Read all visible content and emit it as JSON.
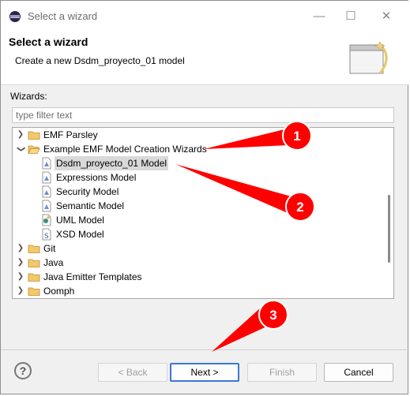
{
  "window": {
    "title": "Select a wizard"
  },
  "header": {
    "title": "Select a wizard",
    "description": "Create a new Dsdm_proyecto_01 model"
  },
  "wizards_label": "Wizards:",
  "filter": {
    "placeholder": "type filter text",
    "value": ""
  },
  "tree": {
    "items": [
      {
        "label": "EMF Parsley",
        "type": "folder",
        "expanded": false
      },
      {
        "label": "Example EMF Model Creation Wizards",
        "type": "folder",
        "expanded": true
      },
      {
        "label": "Dsdm_proyecto_01 Model",
        "type": "model",
        "selected": true
      },
      {
        "label": "Expressions Model",
        "type": "model"
      },
      {
        "label": "Security Model",
        "type": "model"
      },
      {
        "label": "Semantic Model",
        "type": "model"
      },
      {
        "label": "UML Model",
        "type": "uml"
      },
      {
        "label": "XSD Model",
        "type": "xsd"
      },
      {
        "label": "Git",
        "type": "folder",
        "expanded": false
      },
      {
        "label": "Java",
        "type": "folder",
        "expanded": false
      },
      {
        "label": "Java Emitter Templates",
        "type": "folder",
        "expanded": false
      },
      {
        "label": "Oomph",
        "type": "folder",
        "expanded": false
      }
    ]
  },
  "buttons": {
    "back": "< Back",
    "next": "Next >",
    "finish": "Finish",
    "cancel": "Cancel"
  },
  "help_icon": "?",
  "callouts": [
    "1",
    "2",
    "3"
  ],
  "colors": {
    "callout_red": "#ff0000",
    "folder": "#e8b04a",
    "selection": "#d9d9d9",
    "default_button_border": "#3c78d8"
  }
}
